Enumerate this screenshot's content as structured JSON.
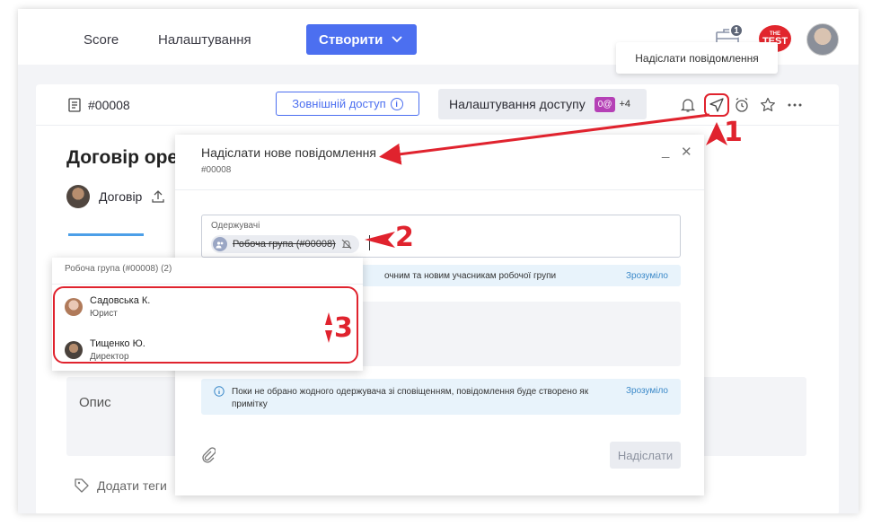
{
  "topbar": {
    "nav": [
      "Score",
      "Налаштування"
    ],
    "create_label": "Створити",
    "notification_count": "1",
    "logo_small": "THE",
    "logo_big": "TEST"
  },
  "tooltip": "Надіслати повідомлення",
  "doc": {
    "id": "#00008",
    "external_access": "Зовнішній доступ",
    "access_settings": "Налаштування доступу",
    "access_pill": "0@",
    "access_count": "+4",
    "title": "Договір оре",
    "subtitle": "Договір",
    "description_label": "Опис",
    "tags_label": "Додати теги"
  },
  "modal": {
    "title": "Надіслати нове повідомлення",
    "subtitle": "#00008",
    "recipients_label": "Одержувачі",
    "recipient_chip": "Робоча група (#00008)",
    "info1_text": "очним та новим учасникам робочої групи",
    "info1_link": "Зрозуміло",
    "info2_text": "Поки не обрано жодного одержувача зі сповіщенням, повідомлення буде створено як примітку",
    "info2_link": "Зрозуміло",
    "send_label": "Надіслати"
  },
  "dropdown": {
    "header": "Робоча група (#00008) (2)",
    "members": [
      {
        "name": "Садовська К.",
        "role": "Юрист"
      },
      {
        "name": "Тищенко Ю.",
        "role": "Директор"
      }
    ]
  },
  "annotations": [
    "1",
    "2",
    "3"
  ],
  "colors": {
    "accent": "#4c6ff0",
    "annotation": "#e0232e",
    "info_bg": "#e8f3fb"
  }
}
